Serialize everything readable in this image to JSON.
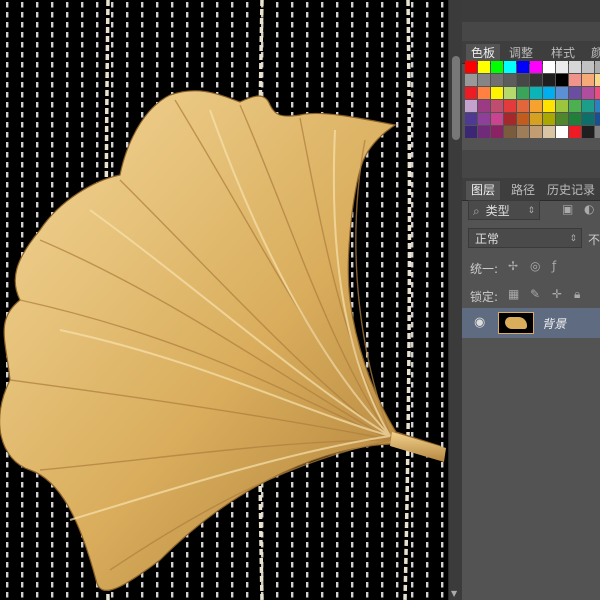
{
  "colors": {
    "canvas_bg": "#000000",
    "leaf_gold": "#d9ad5c",
    "leaf_highlight": "#f4d89a",
    "leaf_shadow": "#a57733",
    "panel_bg": "#535353",
    "layer_selected": "#5e6b80"
  },
  "swatches_panel": {
    "tabs": [
      "色板",
      "调整",
      "样式",
      "颜"
    ],
    "rows": [
      [
        "#ff0000",
        "#ffff00",
        "#00ff00",
        "#00ffff",
        "#0000ff",
        "#ff00ff",
        "#ffffff",
        "#ebebeb",
        "#d6d6d6",
        "#c2c2c2",
        "#adadad"
      ],
      [
        "#999999",
        "#858585",
        "#707070",
        "#5c5c5c",
        "#474747",
        "#333333",
        "#1f1f1f",
        "#000000",
        "#f0938b",
        "#f5aa77",
        "#fbd78a"
      ],
      [
        "#ed1c24",
        "#ff8040",
        "#fff200",
        "#b5d96b",
        "#3aa558",
        "#0bb5b7",
        "#00aeef",
        "#5b8fd6",
        "#6a4ea1",
        "#b04d9e",
        "#ee4b83"
      ],
      [
        "#c3a3cd",
        "#9a3b83",
        "#c04d6f",
        "#e33b3b",
        "#e1663c",
        "#f5a22e",
        "#ffe200",
        "#9bc53d",
        "#4caf50",
        "#1d9e8a",
        "#2a81c2"
      ],
      [
        "#4f3a93",
        "#8e3f99",
        "#c94390",
        "#a5282a",
        "#c25b1e",
        "#d6a021",
        "#aaa700",
        "#51862d",
        "#217f3c",
        "#0d6e6a",
        "#174f95"
      ],
      [
        "#3c2774",
        "#6f2b7a",
        "#8a2263",
        "#7a5c3d",
        "#9e7d58",
        "#c29c72",
        "#d9c4a3",
        "#ffffff",
        "#ed1c24",
        "#1f1f1f",
        "#7f7f7f"
      ]
    ]
  },
  "layers_panel": {
    "tabs": [
      "图层",
      "路径",
      "历史记录"
    ],
    "filter_label": "类型",
    "blend_mode": "正常",
    "opacity_label_partial": "不",
    "unify_label": "统一:",
    "lock_label": "锁定:",
    "layers": [
      {
        "name": "背景",
        "visible": true,
        "selected": true
      }
    ]
  }
}
